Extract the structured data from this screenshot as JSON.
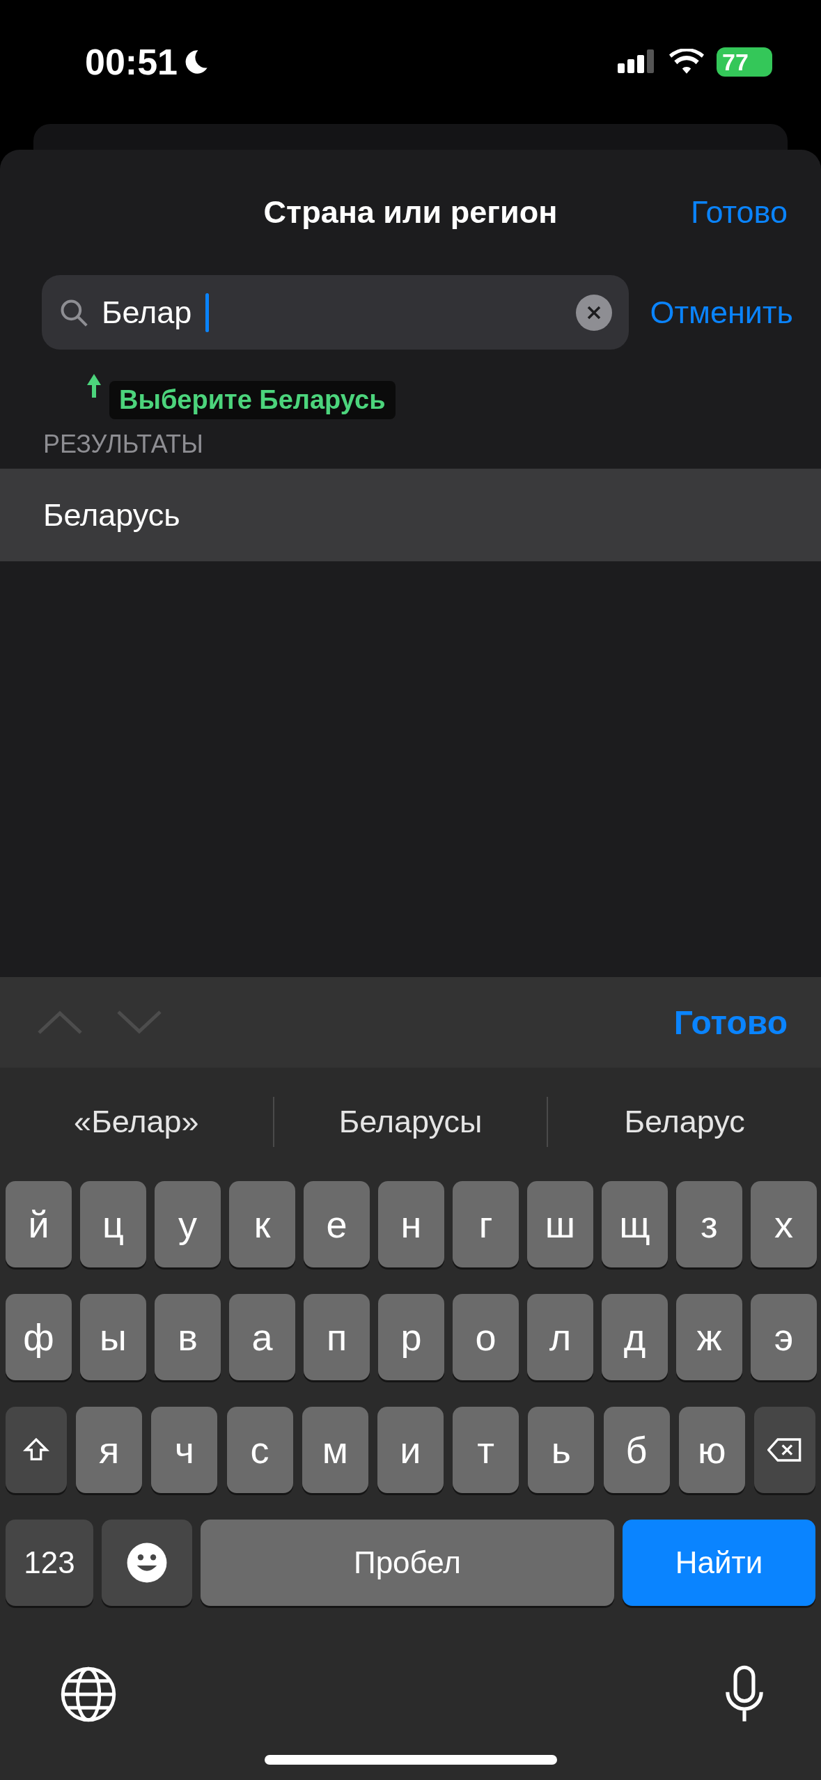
{
  "status_bar": {
    "time": "00:51",
    "battery": "77"
  },
  "sheet": {
    "title": "Страна или регион",
    "done": "Готово"
  },
  "search": {
    "value": "Белар",
    "cancel": "Отменить"
  },
  "hint": {
    "text": "Выберите Беларусь"
  },
  "results": {
    "header": "РЕЗУЛЬТАТЫ",
    "items": [
      {
        "label": "Беларусь",
        "selected": true
      }
    ]
  },
  "keyboard": {
    "toolbar": {
      "done": "Готово"
    },
    "suggestions": [
      "«Белар»",
      "Беларусы",
      "Беларус"
    ],
    "rows": [
      [
        {
          "kind": "letter",
          "label": "й"
        },
        {
          "kind": "letter",
          "label": "ц"
        },
        {
          "kind": "letter",
          "label": "у"
        },
        {
          "kind": "letter",
          "label": "к"
        },
        {
          "kind": "letter",
          "label": "е"
        },
        {
          "kind": "letter",
          "label": "н"
        },
        {
          "kind": "letter",
          "label": "г"
        },
        {
          "kind": "letter",
          "label": "ш"
        },
        {
          "kind": "letter",
          "label": "щ"
        },
        {
          "kind": "letter",
          "label": "з"
        },
        {
          "kind": "letter",
          "label": "х"
        }
      ],
      [
        {
          "kind": "letter",
          "label": "ф"
        },
        {
          "kind": "letter",
          "label": "ы"
        },
        {
          "kind": "letter",
          "label": "в"
        },
        {
          "kind": "letter",
          "label": "а"
        },
        {
          "kind": "letter",
          "label": "п"
        },
        {
          "kind": "letter",
          "label": "р"
        },
        {
          "kind": "letter",
          "label": "о"
        },
        {
          "kind": "letter",
          "label": "л"
        },
        {
          "kind": "letter",
          "label": "д"
        },
        {
          "kind": "letter",
          "label": "ж"
        },
        {
          "kind": "letter",
          "label": "э"
        }
      ],
      [
        {
          "kind": "shift"
        },
        {
          "kind": "letter",
          "label": "я"
        },
        {
          "kind": "letter",
          "label": "ч"
        },
        {
          "kind": "letter",
          "label": "с"
        },
        {
          "kind": "letter",
          "label": "м"
        },
        {
          "kind": "letter",
          "label": "и"
        },
        {
          "kind": "letter",
          "label": "т"
        },
        {
          "kind": "letter",
          "label": "ь"
        },
        {
          "kind": "letter",
          "label": "б"
        },
        {
          "kind": "letter",
          "label": "ю"
        },
        {
          "kind": "delete"
        }
      ]
    ],
    "bottom_keys": [
      {
        "kind": "numbers",
        "label": "123"
      },
      {
        "kind": "emoji"
      },
      {
        "kind": "space",
        "label": "Пробел"
      },
      {
        "kind": "action",
        "label": "Найти"
      }
    ]
  }
}
